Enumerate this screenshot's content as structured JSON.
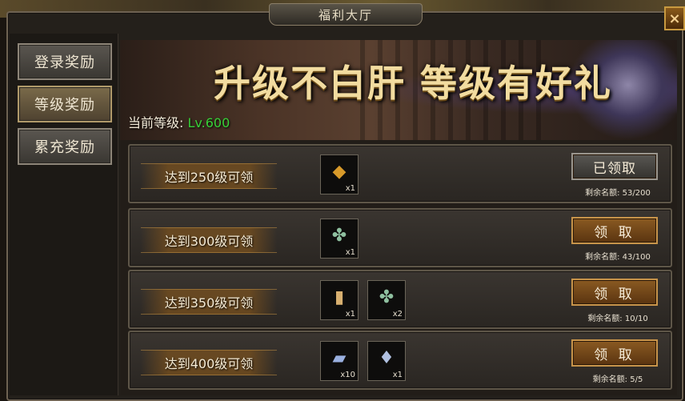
{
  "window": {
    "title": "福利大厅",
    "close_icon": "×"
  },
  "sidebar": {
    "items": [
      {
        "label": "登录奖励",
        "active": false
      },
      {
        "label": "等级奖励",
        "active": true
      },
      {
        "label": "累充奖励",
        "active": false
      }
    ]
  },
  "banner": {
    "title": "升级不白肝 等级有好礼",
    "level_label": "当前等级:",
    "level_value": "Lv.600"
  },
  "rewards": [
    {
      "label": "达到250级可领",
      "items": [
        {
          "icon": "gold-gem-icon",
          "glyph": "◆",
          "color": "#d89a2a",
          "qty": "x1"
        }
      ],
      "button": "已领取",
      "claimed": true,
      "remaining": "剩余名额: 53/200"
    },
    {
      "label": "达到300级可领",
      "items": [
        {
          "icon": "clover-amulet-icon",
          "glyph": "✤",
          "color": "#8fc0a0",
          "qty": "x1"
        }
      ],
      "button": "领 取",
      "claimed": false,
      "remaining": "剩余名额: 43/100"
    },
    {
      "label": "达到350级可领",
      "items": [
        {
          "icon": "gold-bar-icon",
          "glyph": "▮",
          "color": "#d8b070",
          "qty": "x1"
        },
        {
          "icon": "clover-amulet-icon",
          "glyph": "✤",
          "color": "#8fc0a0",
          "qty": "x2"
        }
      ],
      "button": "领 取",
      "claimed": false,
      "remaining": "剩余名额: 10/10"
    },
    {
      "label": "达到400级可领",
      "items": [
        {
          "icon": "silver-ingot-icon",
          "glyph": "▰",
          "color": "#9ab0e0",
          "qty": "x10"
        },
        {
          "icon": "crystal-shard-icon",
          "glyph": "♦",
          "color": "#b0c0e0",
          "qty": "x1"
        }
      ],
      "button": "领 取",
      "claimed": false,
      "remaining": "剩余名额: 5/5"
    }
  ]
}
